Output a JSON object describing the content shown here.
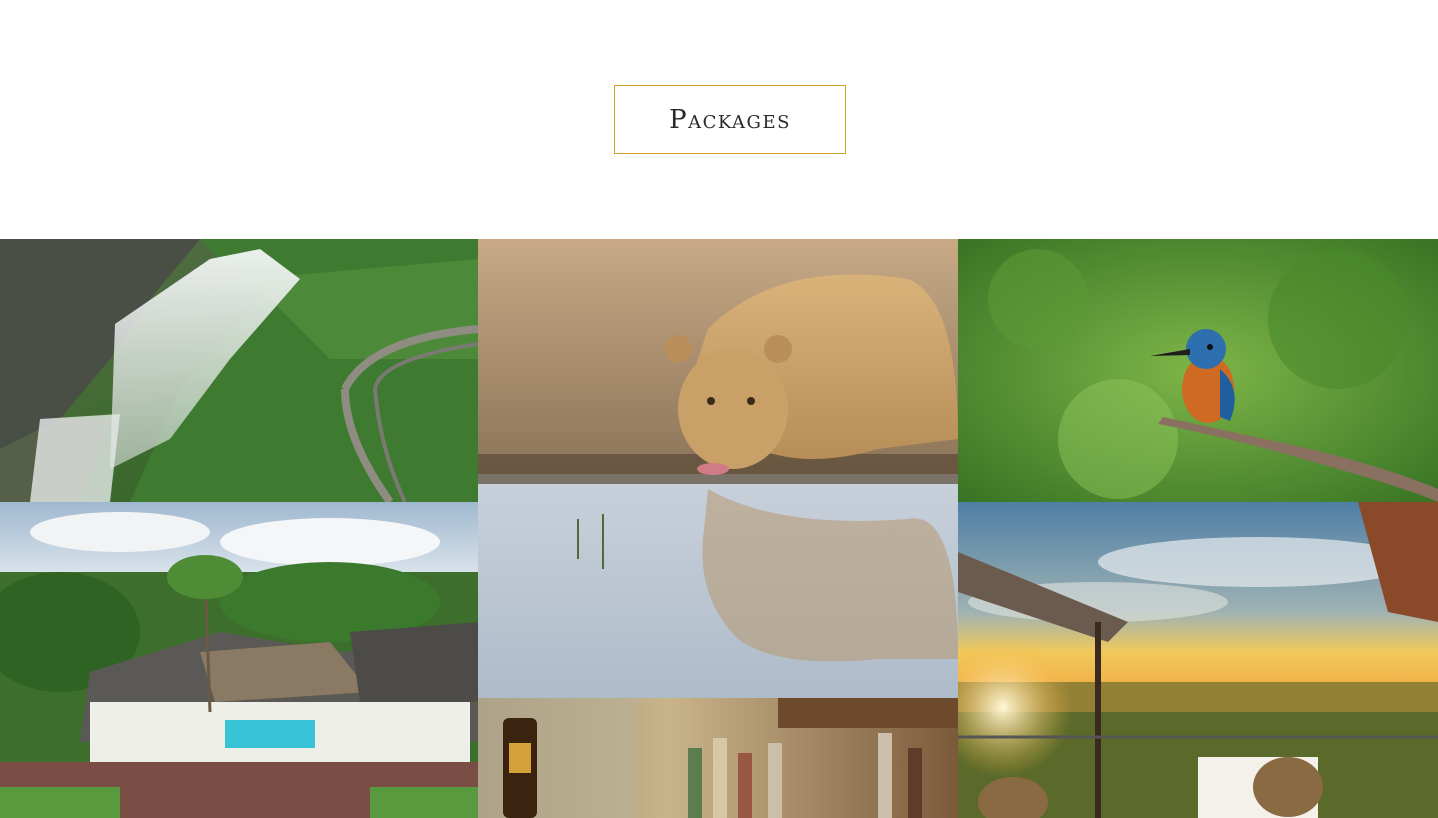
{
  "section": {
    "heading": "Packages"
  },
  "packages": [
    {
      "id": "falls",
      "image": "victoria-falls-aerial-photo"
    },
    {
      "id": "lion",
      "image": "lioness-drinking-photo"
    },
    {
      "id": "kingfisher",
      "image": "kingfisher-bird-photo"
    },
    {
      "id": "lodge",
      "image": "lodge-pool-aerial-photo"
    },
    {
      "id": "bar",
      "image": "bar-bottles-photo"
    },
    {
      "id": "sunset",
      "image": "sunset-terrace-dining-photo"
    }
  ],
  "colors": {
    "heading_border": "#d4a12a",
    "heading_text": "#2a2a2a",
    "background": "#ffffff"
  }
}
